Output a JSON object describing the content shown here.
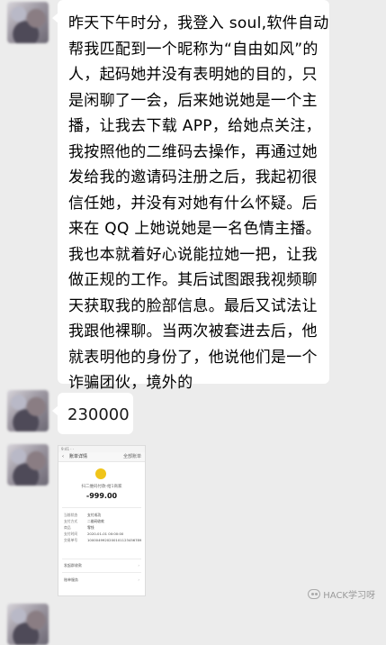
{
  "messages": [
    {
      "type": "text",
      "text": "昨天下午时分，我登入 soul,软件自动帮我匹配到一个昵称为“自由如风”的人，起码她并没有表明她的目的，只是闲聊了一会，后来她说她是一个主播，让我去下载 APP，给她点关注，我按照他的二维码去操作，再通过她发给我的邀请码注册之后，我起初很信任她，并没有对她有什么怀疑。后来在 QQ 上她说她是一名色情主播。我也本就着好心说能拉她一把，让我做正规的工作。其后试图跟我视频聊天获取我的脸部信息。最后又试法让我跟他裸聊。当两次被套进去后，他就表明他的身份了，他说他们是一个诈骗团伙，境外的"
    },
    {
      "type": "text",
      "text": "230000"
    },
    {
      "type": "image",
      "payment": {
        "status_bar": "9:41 ·  ·",
        "nav_back": "‹",
        "nav_title": "账单详情",
        "nav_all": "全部账单",
        "merchant": "扫二维码付款-给1商家",
        "amount": "-999.00",
        "rows": [
          {
            "label": "当前状态",
            "value": "支付成功"
          },
          {
            "label": "支付方式",
            "value": "二维码收款"
          },
          {
            "label": "商品",
            "value": "零钱"
          },
          {
            "label": "支付时间",
            "value": "2020-01-01 00:00:00"
          },
          {
            "label": "交易单号",
            "value": "1000049920200101123456789"
          }
        ],
        "links": [
          "发起群收款",
          "账单服务"
        ]
      }
    }
  ],
  "watermark": "HACK学习呀"
}
